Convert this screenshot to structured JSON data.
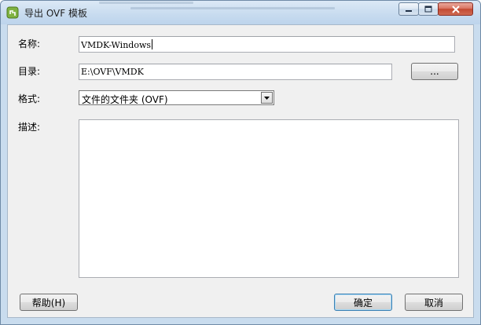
{
  "window": {
    "title": "导出 OVF 模板",
    "icon": "vsphere-export-icon",
    "controls": {
      "minimize": "minimize-icon",
      "maximize": "maximize-icon",
      "close": "close-icon"
    }
  },
  "form": {
    "name_label": "名称:",
    "name_value": "VMDK-Windows",
    "directory_label": "目录:",
    "directory_value": "E:\\OVF\\VMDK",
    "browse_label": "...",
    "format_label": "格式:",
    "format_value": "文件的文件夹 (OVF)",
    "description_label": "描述:",
    "description_value": ""
  },
  "footer": {
    "help_label": "帮助(H)",
    "ok_label": "确定",
    "cancel_label": "取消"
  },
  "colors": {
    "titlebar": "#c7dbef",
    "client": "#f0f0f0",
    "close_button": "#c34a32",
    "default_button_border": "#3c7fb1"
  }
}
